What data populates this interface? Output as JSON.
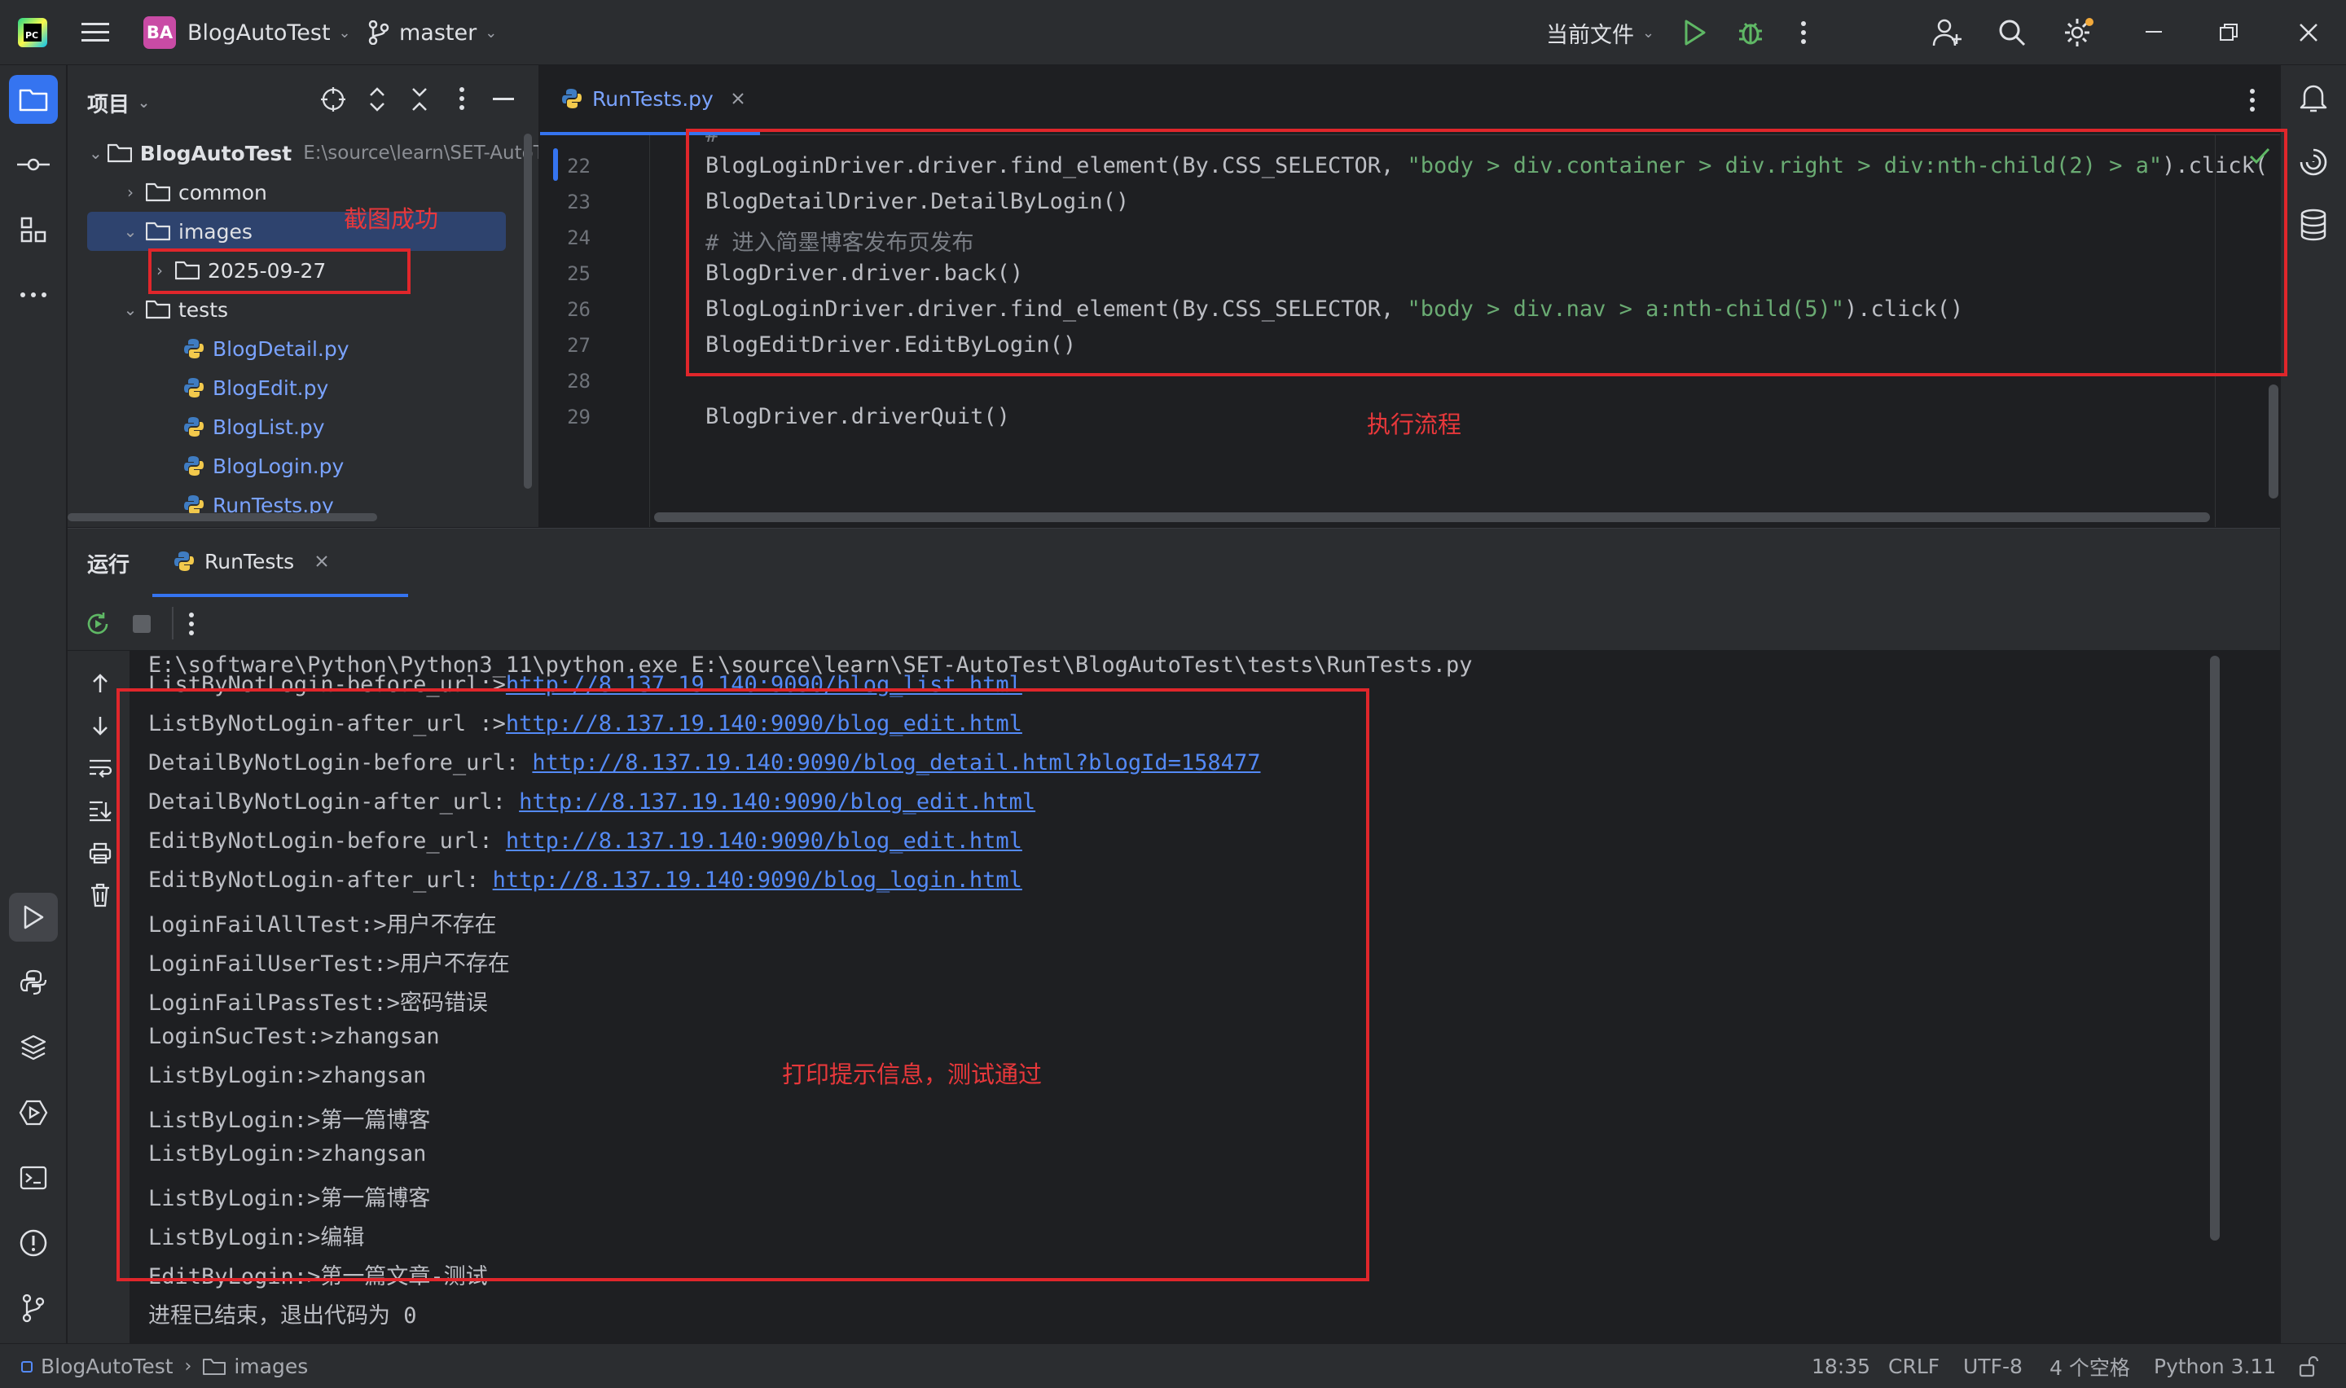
{
  "titlebar": {
    "app_logo_text": "PC",
    "project_badge": "BA",
    "project_name": "BlogAutoTest",
    "branch": "master",
    "run_config": "当前文件"
  },
  "project_panel": {
    "title": "项目",
    "tree": [
      {
        "label": "BlogAutoTest",
        "path": "E:\\source\\learn\\SET-AutoT",
        "kind": "root"
      },
      {
        "label": "common",
        "kind": "folder"
      },
      {
        "label": "images",
        "kind": "folder"
      },
      {
        "label": "2025-09-27",
        "kind": "folder"
      },
      {
        "label": "tests",
        "kind": "folder"
      },
      {
        "label": "BlogDetail.py",
        "kind": "py"
      },
      {
        "label": "BlogEdit.py",
        "kind": "py"
      },
      {
        "label": "BlogList.py",
        "kind": "py"
      },
      {
        "label": "BlogLogin.py",
        "kind": "py"
      },
      {
        "label": "RunTests.py",
        "kind": "py"
      }
    ]
  },
  "editor": {
    "tab": "RunTests.py",
    "lines": [
      {
        "num": "22",
        "parts": [
          {
            "t": "BlogLoginDriver.driver.find_element(By.CSS_SELECTOR, ",
            "c": "code"
          },
          {
            "t": "\"body > div.container > div.right > div:nth-child(2) > a\"",
            "c": "str"
          },
          {
            "t": ").click(",
            "c": "code"
          }
        ]
      },
      {
        "num": "23",
        "parts": [
          {
            "t": "BlogDetailDriver.DetailByLogin()",
            "c": "code"
          }
        ]
      },
      {
        "num": "24",
        "parts": [
          {
            "t": "# 进入简墨博客发布页发布",
            "c": "cmt"
          }
        ]
      },
      {
        "num": "25",
        "parts": [
          {
            "t": "BlogDriver.driver.back()",
            "c": "code"
          }
        ]
      },
      {
        "num": "26",
        "parts": [
          {
            "t": "BlogLoginDriver.driver.find_element(By.CSS_SELECTOR, ",
            "c": "code"
          },
          {
            "t": "\"body > div.nav > a:nth-child(5)\"",
            "c": "str"
          },
          {
            "t": ").click()",
            "c": "code"
          }
        ]
      },
      {
        "num": "27",
        "parts": [
          {
            "t": "BlogEditDriver.EditByLogin()",
            "c": "code"
          }
        ]
      },
      {
        "num": "28",
        "parts": [
          {
            "t": "",
            "c": "code"
          }
        ]
      },
      {
        "num": "29",
        "parts": [
          {
            "t": "BlogDriver.driverQuit()",
            "c": "code"
          }
        ]
      }
    ]
  },
  "run_panel": {
    "title": "运行",
    "tab": "RunTests",
    "command": "E:\\software\\Python\\Python3_11\\python.exe E:\\source\\learn\\SET-AutoTest\\BlogAutoTest\\tests\\RunTests.py",
    "output": [
      {
        "prefix": "ListByNotLogin-before_url:>",
        "link": "http://8.137.19.140:9090/blog_list.html"
      },
      {
        "prefix": "ListByNotLogin-after_url :>",
        "link": "http://8.137.19.140:9090/blog_edit.html"
      },
      {
        "prefix": "DetailByNotLogin-before_url: ",
        "link": "http://8.137.19.140:9090/blog_detail.html?blogId=158477"
      },
      {
        "prefix": "DetailByNotLogin-after_url: ",
        "link": "http://8.137.19.140:9090/blog_edit.html"
      },
      {
        "prefix": "EditByNotLogin-before_url: ",
        "link": "http://8.137.19.140:9090/blog_edit.html"
      },
      {
        "prefix": "EditByNotLogin-after_url: ",
        "link": "http://8.137.19.140:9090/blog_login.html"
      },
      {
        "prefix": "LoginFailAllTest:>用户不存在",
        "link": ""
      },
      {
        "prefix": "LoginFailUserTest:>用户不存在",
        "link": ""
      },
      {
        "prefix": "LoginFailPassTest:>密码错误",
        "link": ""
      },
      {
        "prefix": "LoginSucTest:>zhangsan",
        "link": ""
      },
      {
        "prefix": "ListByLogin:>zhangsan",
        "link": ""
      },
      {
        "prefix": "ListByLogin:>第一篇博客",
        "link": ""
      },
      {
        "prefix": "ListByLogin:>zhangsan",
        "link": ""
      },
      {
        "prefix": "ListByLogin:>第一篇博客",
        "link": ""
      },
      {
        "prefix": "ListByLogin:>编辑",
        "link": ""
      },
      {
        "prefix": "EditByLogin:>第一篇文章-测试",
        "link": ""
      }
    ],
    "exit_message": "进程已结束，退出代码为 0"
  },
  "annotations": {
    "screenshot_ok": "截图成功",
    "flow": "执行流程",
    "print_info": "打印提示信息，测试通过",
    "color": "#e0262b"
  },
  "statusbar": {
    "crumb_project": "BlogAutoTest",
    "crumb_folder": "images",
    "position": "18:35",
    "line_sep": "CRLF",
    "encoding": "UTF-8",
    "indent": "4 个空格",
    "interpreter": "Python 3.11"
  }
}
